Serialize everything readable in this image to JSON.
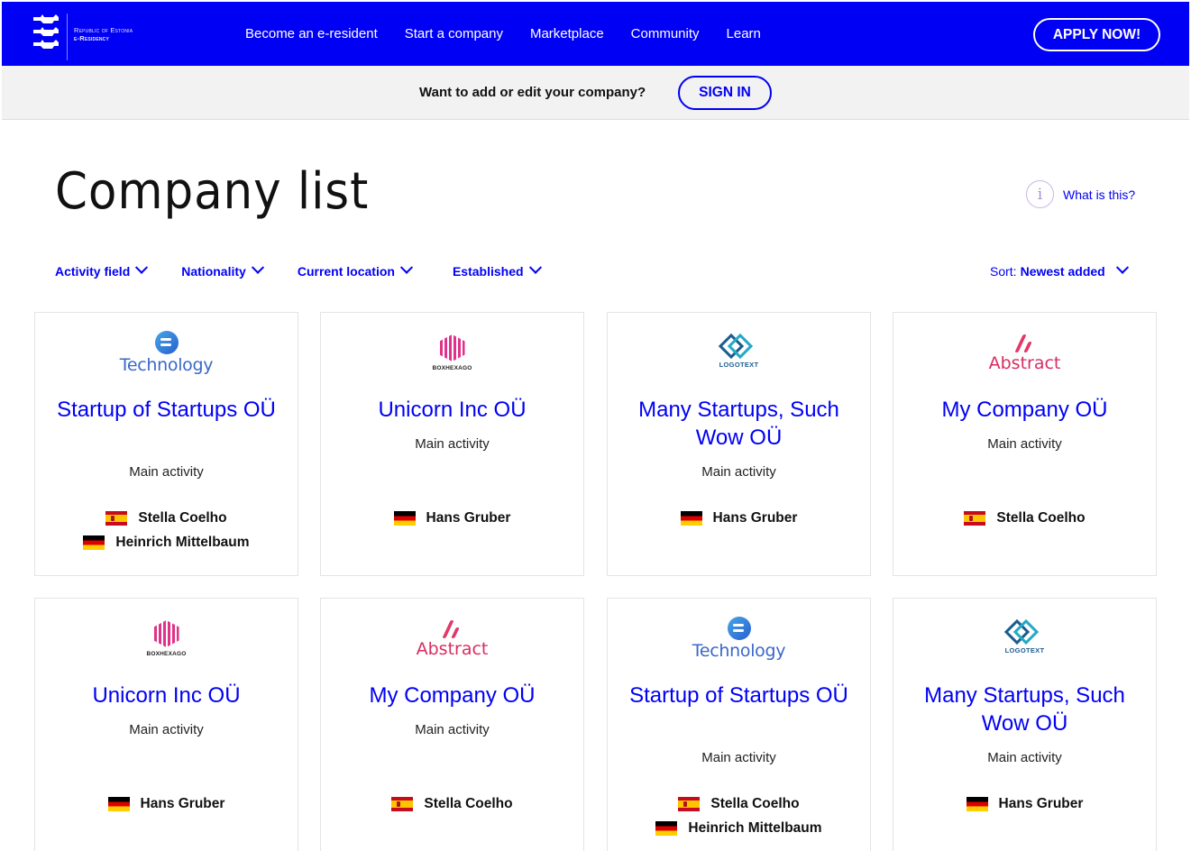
{
  "header": {
    "brand_line1": "Republic of Estonia",
    "brand_line2": "e-Residency",
    "nav": [
      "Become an e-resident",
      "Start a company",
      "Marketplace",
      "Community",
      "Learn"
    ],
    "apply_label": "APPLY NOW!"
  },
  "signin_strip": {
    "prompt": "Want to add or edit your company?",
    "signin_label": "SIGN IN"
  },
  "page": {
    "title": "Company list",
    "whatis_label": "What is this?",
    "info_glyph": "i"
  },
  "filters": [
    "Activity field",
    "Nationality",
    "Current location",
    "Established"
  ],
  "sort": {
    "label": "Sort:",
    "value": "Newest added"
  },
  "logos": {
    "technology": "Technology",
    "boxhexago": "BOXHEXAGO",
    "logotext": "LOGOTEXT",
    "abstract": "Abstract"
  },
  "companies": [
    {
      "logo": "technology",
      "name": "Startup of Startups OÜ",
      "activity": "Main activity",
      "founders": [
        {
          "flag": "es",
          "name": "Stella Coelho"
        },
        {
          "flag": "de",
          "name": "Heinrich Mittelbaum"
        }
      ]
    },
    {
      "logo": "boxhexago",
      "name": "Unicorn Inc OÜ",
      "activity": "Main activity",
      "founders": [
        {
          "flag": "de",
          "name": "Hans Gruber"
        }
      ]
    },
    {
      "logo": "logotext",
      "name": "Many Startups, Such Wow OÜ",
      "activity": "Main activity",
      "founders": [
        {
          "flag": "de",
          "name": "Hans Gruber"
        }
      ]
    },
    {
      "logo": "abstract",
      "name": "My Company OÜ",
      "activity": "Main activity",
      "founders": [
        {
          "flag": "es",
          "name": "Stella Coelho"
        }
      ]
    },
    {
      "logo": "boxhexago",
      "name": "Unicorn Inc OÜ",
      "activity": "Main activity",
      "founders": [
        {
          "flag": "de",
          "name": "Hans Gruber"
        }
      ]
    },
    {
      "logo": "abstract",
      "name": "My Company OÜ",
      "activity": "Main activity",
      "founders": [
        {
          "flag": "es",
          "name": "Stella Coelho"
        }
      ]
    },
    {
      "logo": "technology",
      "name": "Startup of Startups OÜ",
      "activity": "Main activity",
      "founders": [
        {
          "flag": "es",
          "name": "Stella Coelho"
        },
        {
          "flag": "de",
          "name": "Heinrich Mittelbaum"
        }
      ]
    },
    {
      "logo": "logotext",
      "name": "Many Startups, Such Wow OÜ",
      "activity": "Main activity",
      "founders": [
        {
          "flag": "de",
          "name": "Hans Gruber"
        }
      ]
    }
  ],
  "colors": {
    "brand_blue": "#0000f5",
    "strip_bg": "#f2f2f2"
  }
}
